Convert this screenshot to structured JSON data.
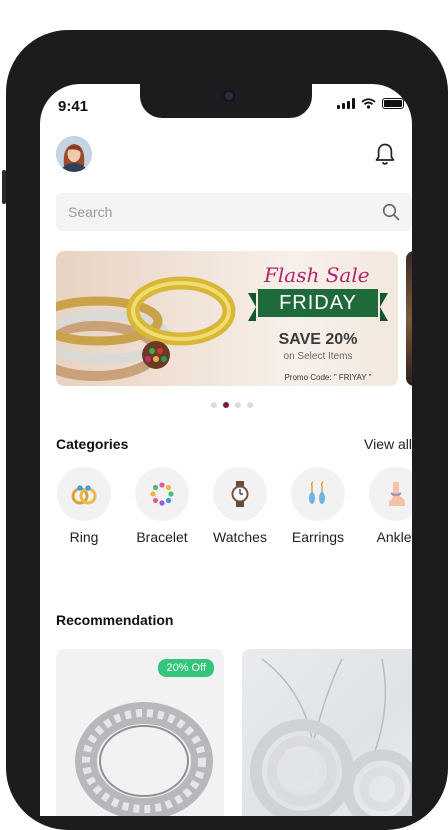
{
  "status_bar": {
    "time": "9:41"
  },
  "search": {
    "placeholder": "Search"
  },
  "banner": {
    "headline": "Flash Sale",
    "day": "FRIDAY",
    "offer": "SAVE 20%",
    "subtitle": "on Select Items",
    "promo": "Promo Code: \" FRIYAY \""
  },
  "carousel": {
    "count": 4,
    "active_index": 1
  },
  "categories": {
    "title": "Categories",
    "view_all": "View all",
    "items": [
      {
        "label": "Ring",
        "icon": "ring-icon"
      },
      {
        "label": "Bracelet",
        "icon": "bracelet-icon"
      },
      {
        "label": "Watches",
        "icon": "watch-icon"
      },
      {
        "label": "Earrings",
        "icon": "earrings-icon"
      },
      {
        "label": "Anklet",
        "icon": "anklet-icon"
      }
    ]
  },
  "recommendation": {
    "title": "Recommendation",
    "products": [
      {
        "badge": "20% Off",
        "image": "silver-ring"
      },
      {
        "image": "silver-pendant-necklace"
      }
    ]
  },
  "colors": {
    "accent": "#7b1b3a",
    "badge": "#34c77b",
    "banner_green": "#1e6a3a",
    "flash_pink": "#b5236c"
  }
}
